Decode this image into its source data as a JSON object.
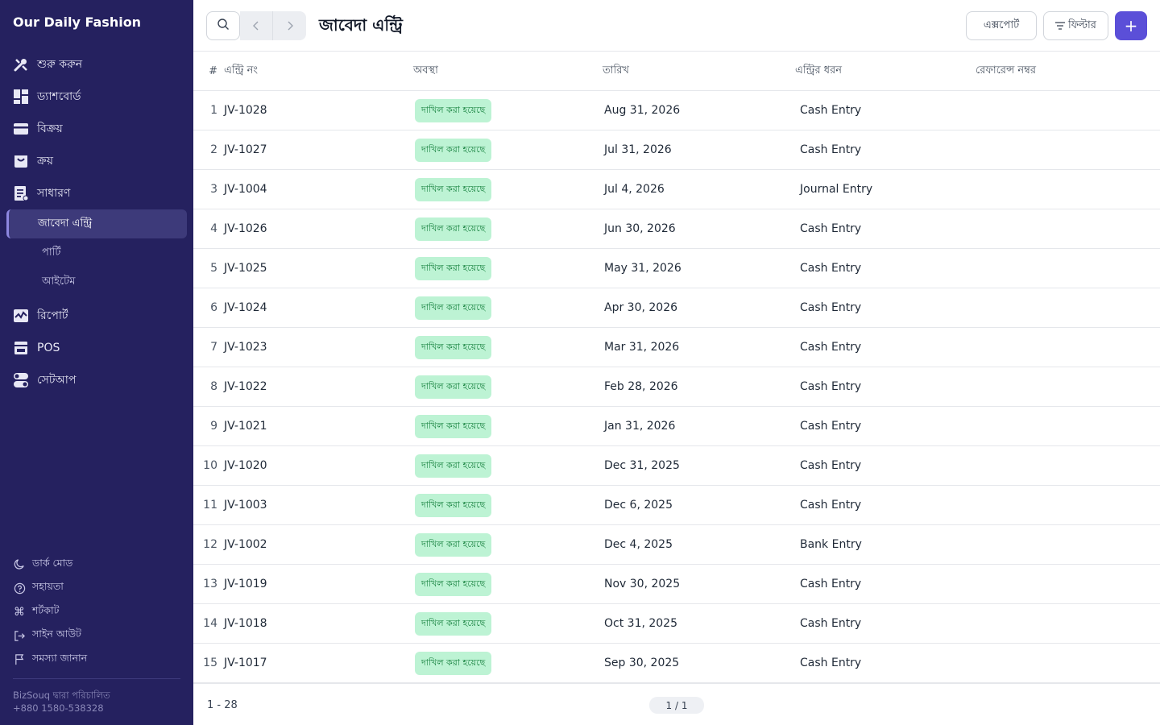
{
  "app": {
    "name": "Our Daily Fashion"
  },
  "sidebar": {
    "items": [
      {
        "label": "শুরু করুন",
        "icon": "tools-icon"
      },
      {
        "label": "ড্যাশবোর্ড",
        "icon": "dashboard-icon"
      },
      {
        "label": "বিক্রয়",
        "icon": "card-icon"
      },
      {
        "label": "ক্রয়",
        "icon": "bag-icon"
      },
      {
        "label": "সাধারণ",
        "icon": "ledger-icon"
      }
    ],
    "sub_items": [
      {
        "label": "জাবেদা এন্ট্রি",
        "active": true
      },
      {
        "label": "পার্টি",
        "active": false
      },
      {
        "label": "আইটেম",
        "active": false
      }
    ],
    "items2": [
      {
        "label": "রিপোর্ট",
        "icon": "chart-icon"
      },
      {
        "label": "POS",
        "icon": "pos-icon"
      },
      {
        "label": "সেটআপ",
        "icon": "toggle-icon"
      }
    ],
    "bottom_links": [
      {
        "label": "ডার্ক মোড",
        "icon": "moon-icon"
      },
      {
        "label": "সহায়তা",
        "icon": "help-icon"
      },
      {
        "label": "শর্টকাট",
        "icon": "command-icon"
      },
      {
        "label": "সাইন আউট",
        "icon": "signout-icon"
      },
      {
        "label": "সমস্যা জানান",
        "icon": "flag-icon"
      }
    ],
    "footer_line1": "BizSouq দ্বারা পরিচালিত",
    "footer_line2": "+880 1580-538328"
  },
  "header": {
    "title": "জাবেদা এন্ট্রি",
    "export_label": "এক্সপোর্ট",
    "filter_label": "ফিল্টার",
    "add_label": "+"
  },
  "table": {
    "columns": {
      "num": "#",
      "entry": "এন্ট্রি নং",
      "status": "অবস্থা",
      "date": "তারিখ",
      "type": "এন্ট্রির ধরন",
      "ref": "রেফারেন্স নম্বর"
    },
    "rows": [
      {
        "num": "1",
        "entry": "JV-1028",
        "status": "দাখিল করা হয়েছে",
        "date": "Aug 31, 2026",
        "type": "Cash Entry",
        "ref": ""
      },
      {
        "num": "2",
        "entry": "JV-1027",
        "status": "দাখিল করা হয়েছে",
        "date": "Jul 31, 2026",
        "type": "Cash Entry",
        "ref": ""
      },
      {
        "num": "3",
        "entry": "JV-1004",
        "status": "দাখিল করা হয়েছে",
        "date": "Jul 4, 2026",
        "type": "Journal Entry",
        "ref": ""
      },
      {
        "num": "4",
        "entry": "JV-1026",
        "status": "দাখিল করা হয়েছে",
        "date": "Jun 30, 2026",
        "type": "Cash Entry",
        "ref": ""
      },
      {
        "num": "5",
        "entry": "JV-1025",
        "status": "দাখিল করা হয়েছে",
        "date": "May 31, 2026",
        "type": "Cash Entry",
        "ref": ""
      },
      {
        "num": "6",
        "entry": "JV-1024",
        "status": "দাখিল করা হয়েছে",
        "date": "Apr 30, 2026",
        "type": "Cash Entry",
        "ref": ""
      },
      {
        "num": "7",
        "entry": "JV-1023",
        "status": "দাখিল করা হয়েছে",
        "date": "Mar 31, 2026",
        "type": "Cash Entry",
        "ref": ""
      },
      {
        "num": "8",
        "entry": "JV-1022",
        "status": "দাখিল করা হয়েছে",
        "date": "Feb 28, 2026",
        "type": "Cash Entry",
        "ref": ""
      },
      {
        "num": "9",
        "entry": "JV-1021",
        "status": "দাখিল করা হয়েছে",
        "date": "Jan 31, 2026",
        "type": "Cash Entry",
        "ref": ""
      },
      {
        "num": "10",
        "entry": "JV-1020",
        "status": "দাখিল করা হয়েছে",
        "date": "Dec 31, 2025",
        "type": "Cash Entry",
        "ref": ""
      },
      {
        "num": "11",
        "entry": "JV-1003",
        "status": "দাখিল করা হয়েছে",
        "date": "Dec 6, 2025",
        "type": "Cash Entry",
        "ref": ""
      },
      {
        "num": "12",
        "entry": "JV-1002",
        "status": "দাখিল করা হয়েছে",
        "date": "Dec 4, 2025",
        "type": "Bank Entry",
        "ref": ""
      },
      {
        "num": "13",
        "entry": "JV-1019",
        "status": "দাখিল করা হয়েছে",
        "date": "Nov 30, 2025",
        "type": "Cash Entry",
        "ref": ""
      },
      {
        "num": "14",
        "entry": "JV-1018",
        "status": "দাখিল করা হয়েছে",
        "date": "Oct 31, 2025",
        "type": "Cash Entry",
        "ref": ""
      },
      {
        "num": "15",
        "entry": "JV-1017",
        "status": "দাখিল করা হয়েছে",
        "date": "Sep 30, 2025",
        "type": "Cash Entry",
        "ref": ""
      }
    ]
  },
  "footer": {
    "range": "1 - 28",
    "page": "1 / 1"
  },
  "colors": {
    "sidebar_bg": "#25215f",
    "accent": "#5b4fd8",
    "badge_bg": "#bdf3d4",
    "badge_text": "#15803d"
  }
}
